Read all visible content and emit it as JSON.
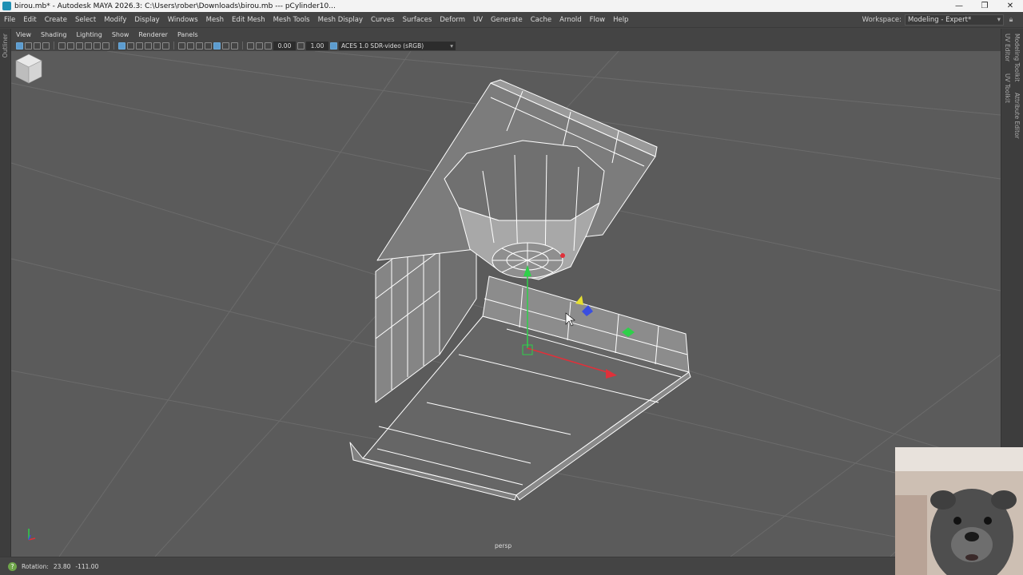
{
  "titlebar": {
    "title": "birou.mb* - Autodesk MAYA 2026.3: C:\\Users\\rober\\Downloads\\birou.mb  ---  pCylinder10...",
    "minimize": "—",
    "maximize": "❐",
    "close": "✕"
  },
  "menubar": {
    "items": [
      "File",
      "Edit",
      "Create",
      "Select",
      "Modify",
      "Display",
      "Windows",
      "Mesh",
      "Edit Mesh",
      "Mesh Tools",
      "Mesh Display",
      "Curves",
      "Surfaces",
      "Deform",
      "UV",
      "Generate",
      "Cache",
      "Arnold",
      "Flow",
      "Help"
    ],
    "workspace_label": "Workspace:",
    "workspace_value": "Modeling - Expert*"
  },
  "left_strip": {
    "label": "Outliner"
  },
  "right_strip": {
    "tabs": [
      "UV Editor",
      "Modeling Toolkit",
      "UV Toolkit",
      "Attribute Editor"
    ]
  },
  "panel_menu": {
    "items": [
      "View",
      "Shading",
      "Lighting",
      "Show",
      "Renderer",
      "Panels"
    ]
  },
  "panel_toolbar": {
    "exposure": "0.00",
    "gamma": "1.00",
    "colorspace": "ACES 1.0 SDR-video (sRGB)"
  },
  "viewport": {
    "camera_label": "persp"
  },
  "statusbar": {
    "help": "?",
    "label": "Rotation:",
    "value_x": "23.80",
    "value_y": "-111.00"
  },
  "colors": {
    "viewport_bg": "#5b5b5b",
    "mesh_fill": "#7a7a7a",
    "wire": "#ffffff",
    "manip_y": "#2fd04a",
    "manip_x": "#e0303a",
    "manip_z": "#3a4ee0",
    "accent": "#5d9ccf"
  }
}
